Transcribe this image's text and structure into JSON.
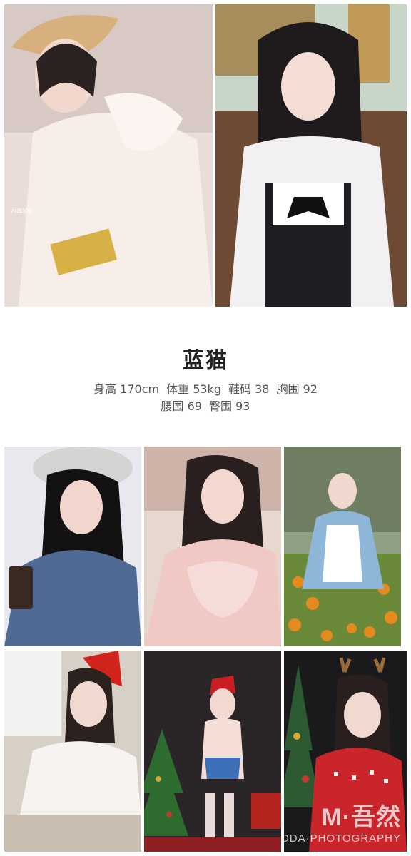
{
  "model": {
    "name": "蓝猫",
    "stats_line1": [
      "身高 170cm",
      "体重 53kg",
      "鞋码 38",
      "胸围 92"
    ],
    "stats_line2": [
      "腰围 69",
      "臀围 93"
    ]
  },
  "photos": {
    "top_left_caption": "Happy"
  },
  "watermark": {
    "main": "M·吾然",
    "sub": "MODA·PHOTOGRAPHY"
  },
  "colors": {
    "background": "#ffffff",
    "name_text": "#222222",
    "stats_text": "#555555"
  }
}
